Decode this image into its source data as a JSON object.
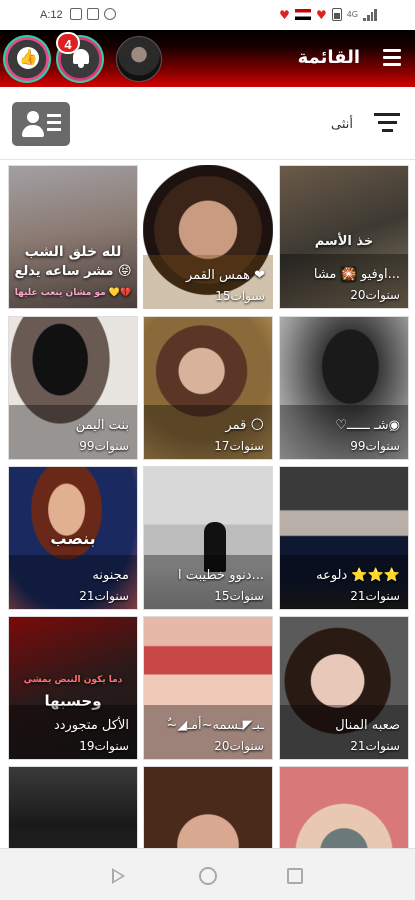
{
  "status_bar": {
    "time": "A:12",
    "network": "4G"
  },
  "header": {
    "title": "القائمة",
    "notification_count": "4"
  },
  "toolbar": {
    "filter_label": "أنثى"
  },
  "colors": {
    "header_top": "#000000",
    "header_bottom": "#d40000",
    "badge": "#e02020",
    "contact_button": "#6a6a6a"
  },
  "cards": [
    {
      "name": "",
      "age": "",
      "overlay_1": "لله خلق الشب",
      "overlay_2": "مشر ساعه يدلع 😝",
      "overlay_3": "مو مشان ينعب عليها 💛💔"
    },
    {
      "name": "همس القمر ❤",
      "age": "15سنوات"
    },
    {
      "name": "اوفيو 🎇 مشا...",
      "age": "20سنوات",
      "overlay_1": "خذ الأسم"
    },
    {
      "name": "بنت اليمن",
      "age": "99سنوات"
    },
    {
      "name": "قمر 🌕",
      "age": "17سنوات"
    },
    {
      "name": "♡شـ ــــــ◉ِ",
      "age": "99سنوات"
    },
    {
      "name": "مجنونه",
      "age": "21سنوات",
      "overlay_1": "بنصب"
    },
    {
      "name": "دنوو خطيبت ا...",
      "age": "15سنوات"
    },
    {
      "name": "دلوعه ⭐⭐⭐",
      "age": "21سنوات"
    },
    {
      "name": "الأكل متجوردد",
      "age": "19سنوات",
      "overlay_1": "دما يكون النبض يمشي",
      "overlay_2": "وحسبها"
    },
    {
      "name": "~ٌ◢ـبـ◤ـسمه~أمـ",
      "age": "20سنوات"
    },
    {
      "name": "صعبه المنال",
      "age": "21سنوات"
    },
    {
      "name": "",
      "age": ""
    },
    {
      "name": "",
      "age": ""
    },
    {
      "name": "",
      "age": ""
    }
  ]
}
